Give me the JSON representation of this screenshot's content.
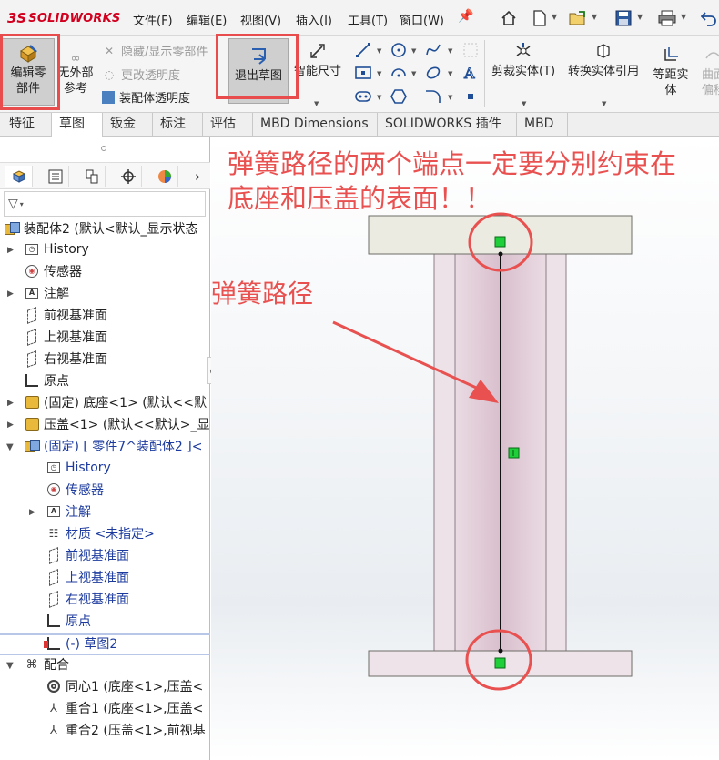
{
  "app": {
    "logo_prefix": "3S",
    "logo_name": "SOLIDWORKS"
  },
  "menu": [
    "文件(F)",
    "编辑(E)",
    "视图(V)",
    "插入(I)",
    "工具(T)",
    "窗口(W)"
  ],
  "quick_access_icons": [
    "home-icon",
    "new-document-icon",
    "open-icon",
    "save-icon",
    "print-icon",
    "undo-icon"
  ],
  "ribbon": {
    "edit_component": "编辑零\n部件",
    "no_external_ref": "无外部\n参考",
    "hide_show_parts": "隐藏/显示零部件",
    "change_transparency": "更改透明度",
    "assembly_transparency": "装配体透明度",
    "exit_sketch": "退出草图",
    "smart_dimension": "智能尺寸",
    "trim_entities": "剪裁实体(T)",
    "convert_entities": "转换实体引用",
    "offset_entities": "等距实\n体",
    "surface_offset": "曲面\n偏移"
  },
  "tabs": [
    {
      "label": "特征",
      "active": false
    },
    {
      "label": "草图",
      "active": true
    },
    {
      "label": "钣金",
      "active": false
    },
    {
      "label": "标注",
      "active": false
    },
    {
      "label": "评估",
      "active": false
    },
    {
      "label": "MBD Dimensions",
      "active": false
    },
    {
      "label": "SOLIDWORKS 插件",
      "active": false
    },
    {
      "label": "MBD",
      "active": false
    }
  ],
  "tree": {
    "root": "装配体2 (默认<默认_显示状态",
    "items": [
      {
        "label": "History",
        "icon": "history-icon"
      },
      {
        "label": "传感器",
        "icon": "sensor-icon"
      },
      {
        "label": "注解",
        "icon": "annotation-icon"
      },
      {
        "label": "前视基准面",
        "icon": "plane-icon"
      },
      {
        "label": "上视基准面",
        "icon": "plane-icon"
      },
      {
        "label": "右视基准面",
        "icon": "plane-icon"
      },
      {
        "label": "原点",
        "icon": "origin-icon"
      },
      {
        "label": "(固定) 底座<1> (默认<<默",
        "icon": "part-icon"
      },
      {
        "label": "压盖<1> (默认<<默认>_显",
        "icon": "part-icon"
      },
      {
        "label": "(固定) [ 零件7^装配体2 ]<",
        "icon": "part-edit-icon"
      },
      {
        "label": "History",
        "icon": "history-icon"
      },
      {
        "label": "传感器",
        "icon": "sensor-icon"
      },
      {
        "label": "注解",
        "icon": "annotation-icon"
      },
      {
        "label": "材质 <未指定>",
        "icon": "material-icon"
      },
      {
        "label": "前视基准面",
        "icon": "plane-icon"
      },
      {
        "label": "上视基准面",
        "icon": "plane-icon"
      },
      {
        "label": "右视基准面",
        "icon": "plane-icon"
      },
      {
        "label": "原点",
        "icon": "origin-icon"
      },
      {
        "label": "(-) 草图2",
        "icon": "sketch-icon"
      },
      {
        "label": "配合",
        "icon": "mates-icon"
      },
      {
        "label": "同心1 (底座<1>,压盖<",
        "icon": "concentric-icon"
      },
      {
        "label": "重合1 (底座<1>,压盖<",
        "icon": "coincident-icon"
      },
      {
        "label": "重合2 (压盖<1>,前视基",
        "icon": "coincident-icon"
      }
    ]
  },
  "annotations": {
    "title_line1": "弹簧路径的两个端点一定要分别约束在",
    "title_line2": "底座和压盖的表面！！",
    "spring_path": "弹簧路径"
  },
  "colors": {
    "annotation_red": "#e8514f",
    "highlight_box": "#e84c4c",
    "cap_fill": "#ecebe1",
    "body_fill": "#e2ccd8",
    "point_green": "#1fcf3a"
  }
}
